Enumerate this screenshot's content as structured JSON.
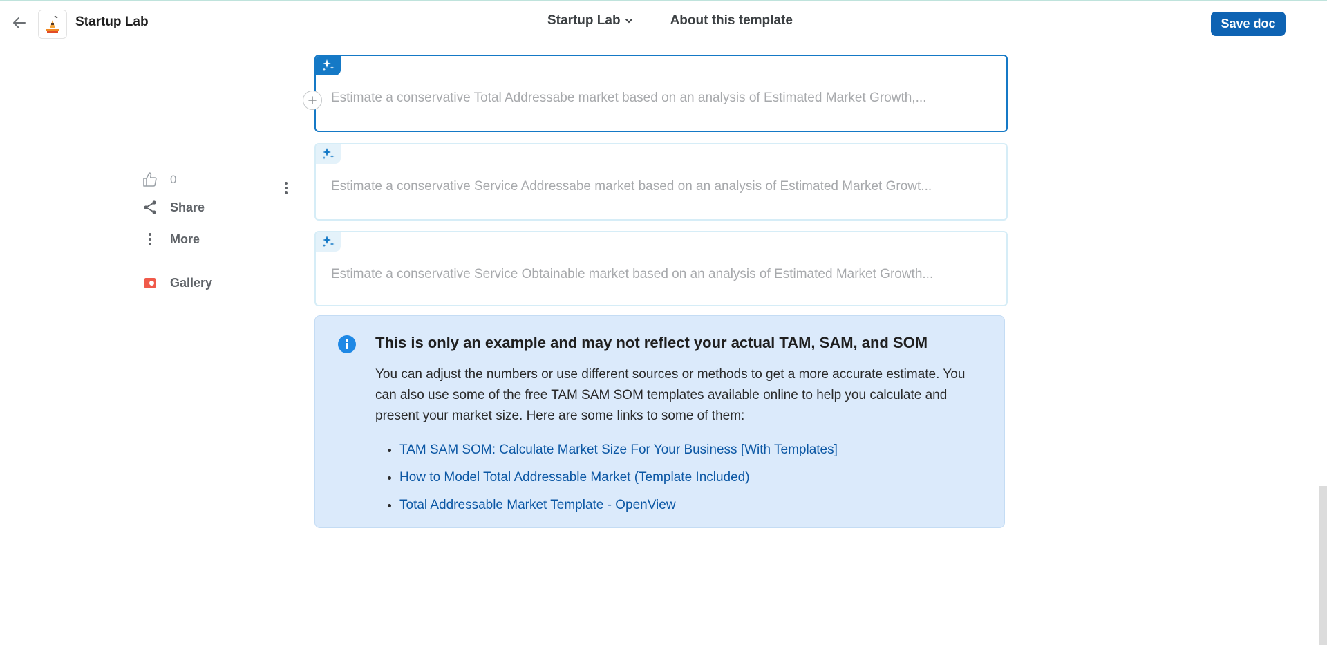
{
  "header": {
    "title": "Startup Lab",
    "nav": [
      {
        "label": "Startup Lab",
        "has_dropdown": true
      },
      {
        "label": "About this template"
      }
    ],
    "save_label": "Save doc"
  },
  "sidebar": {
    "like_count": "0",
    "share_label": "Share",
    "more_label": "More",
    "gallery_label": "Gallery"
  },
  "ai_blocks": [
    {
      "prompt": "Estimate a conservative Total Addressabe market based on an analysis of Estimated Market Growth,..."
    },
    {
      "prompt": "Estimate a conservative Service Addressabe market based on an analysis of Estimated Market Growt..."
    },
    {
      "prompt": "Estimate a conservative Service Obtainable market based on an analysis of Estimated Market Growth..."
    }
  ],
  "callout": {
    "title": "This is only an example and may not reflect your actual TAM, SAM, and SOM",
    "body": "You can adjust the numbers or use different sources or methods to get a more accurate estimate. You can also use some of the free TAM SAM SOM templates available online to help you calculate and present your market size. Here are some links to some of them:",
    "links": [
      "TAM SAM SOM: Calculate Market Size For Your Business [With Templates]",
      "How to Model Total Addressable Market (Template Included)",
      "Total Addressable Market Template - OpenView"
    ]
  },
  "colors": {
    "accent": "#0e63b3",
    "ai_active": "#1579c6",
    "callout_bg": "#dbeafb",
    "link": "#0b57a4",
    "gallery_icon": "#f05a4a"
  }
}
